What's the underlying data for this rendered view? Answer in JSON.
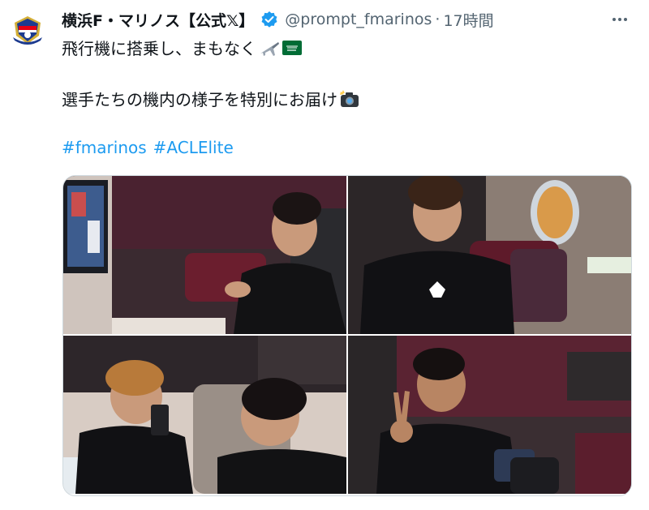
{
  "tweet": {
    "display_name": "横浜F・マリノス【公式𝕏】",
    "handle": "@prompt_fmarinos",
    "separator": "·",
    "time": "17時間",
    "line1": "飛行機に搭乗し、まもなく",
    "line2": "選手たちの機内の様子を特別にお届け",
    "hashtags": [
      "#fmarinos",
      "#ACLElite"
    ],
    "icons": {
      "avatar": "club-crest",
      "verified": "verified-badge-icon",
      "more": "more-options-icon",
      "airplane": "airplane-emoji",
      "flag": "saudi-flag-emoji",
      "camera": "camera-flash-emoji"
    },
    "colors": {
      "link": "#1d9bf0",
      "verified": "#1d9bf0",
      "muted": "#536471"
    }
  },
  "media": {
    "photos": [
      {
        "name": "photo-player-with-screen"
      },
      {
        "name": "photo-player-window-seat"
      },
      {
        "name": "photo-two-players-talking"
      },
      {
        "name": "photo-player-peace-sign"
      }
    ]
  }
}
